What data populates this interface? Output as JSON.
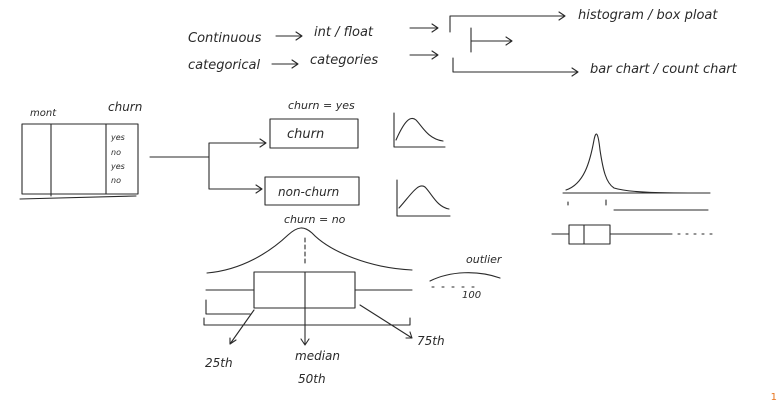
{
  "top_flow": {
    "continuous": "Continuous",
    "int_float": "int / float",
    "categorical": "categorical",
    "categories": "categories",
    "histogram_boxplot": "histogram / box ploat",
    "barchart_countchart": "bar chart / count chart"
  },
  "table": {
    "col_month": "mont",
    "col_churn": "churn",
    "values": [
      "yes",
      "no",
      "yes",
      "no"
    ]
  },
  "split": {
    "churn_eq_yes": "churn = yes",
    "churn_box": "churn",
    "nonchurn_box": "non-churn",
    "churn_eq_no": "churn = no"
  },
  "boxplot": {
    "outlier": "outlier",
    "hundred": "100",
    "p25": "25th",
    "median": "median",
    "p50": "50th",
    "p75": "75th"
  },
  "page_number": "1",
  "colors": {
    "ink": "#2a2a2a",
    "page_number": "#e8741c"
  }
}
